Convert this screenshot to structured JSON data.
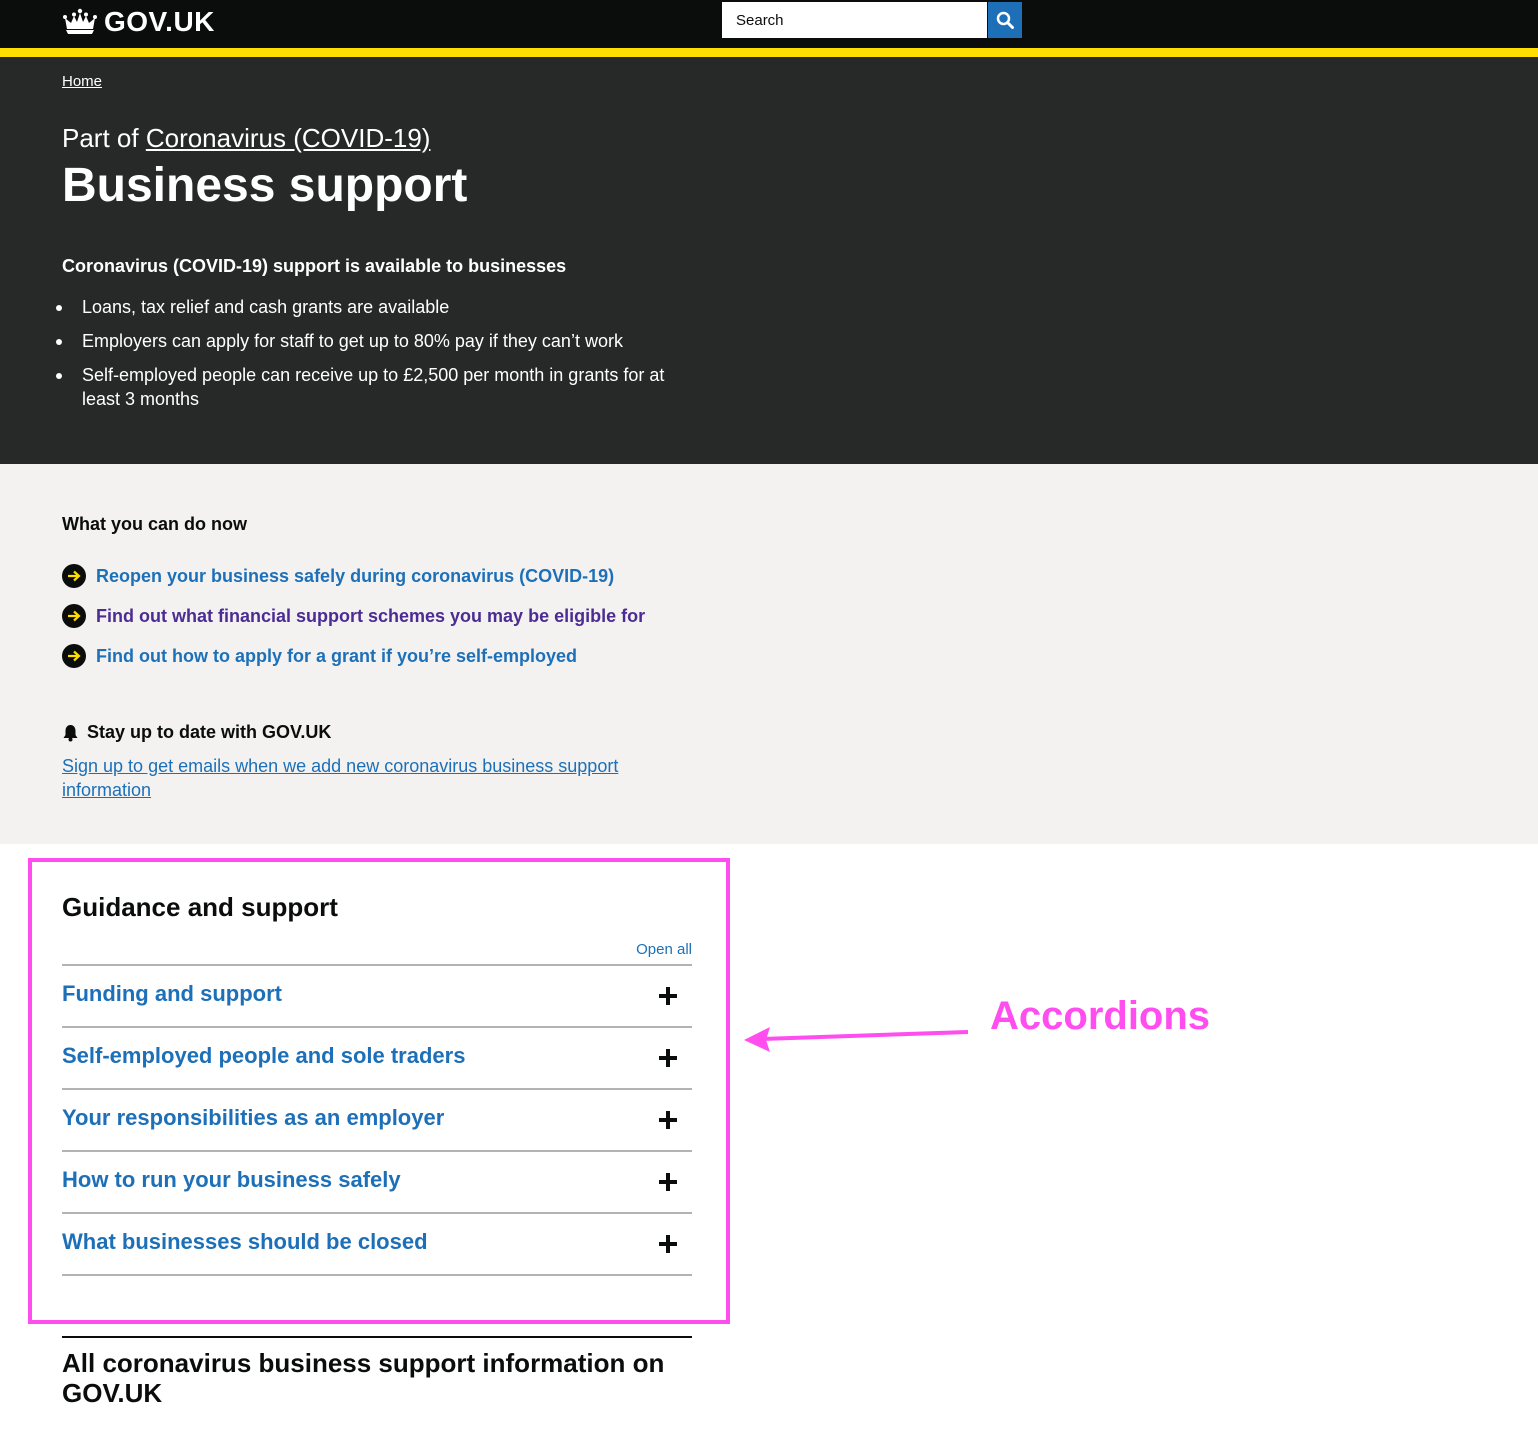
{
  "header": {
    "logo_text": "GOV.UK",
    "search_placeholder": "Search",
    "colors": {
      "background": "#0b0c0c",
      "accent_bar": "#ffdd00",
      "search_button": "#1d70b8"
    }
  },
  "hero": {
    "breadcrumb": "Home",
    "part_of_prefix": "Part of",
    "part_of_link": "Coronavirus (COVID-19)",
    "title": "Business support",
    "subheading": "Coronavirus (COVID-19) support is available to businesses",
    "bullets": [
      "Loans, tax relief and cash grants are available",
      "Employers can apply for staff to get up to 80% pay if they can’t work",
      "Self-employed people can receive up to £2,500 per month in grants for at least 3 months"
    ],
    "background": "#272828"
  },
  "actions": {
    "title": "What you can do now",
    "links": [
      "Reopen your business safely during coronavirus (COVID-19)",
      "Find out what financial support schemes you may be eligible for",
      "Find out how to apply for a grant if you’re self-employed"
    ],
    "link_color": "#1d70b8",
    "visited_color": "#4c2c92"
  },
  "stay": {
    "title": "Stay up to date with GOV.UK",
    "link": "Sign up to get emails when we add new coronavirus business support information"
  },
  "guidance": {
    "title": "Guidance and support",
    "open_all": "Open all",
    "sections": [
      "Funding and support",
      "Self-employed people and sole traders",
      "Your responsibilities as an employer",
      "How to run your business safely",
      "What businesses should be closed"
    ]
  },
  "annotation": {
    "label": "Accordions",
    "color": "#ff4df0"
  },
  "all_info": {
    "title": "All coronavirus business support information on GOV.UK"
  }
}
